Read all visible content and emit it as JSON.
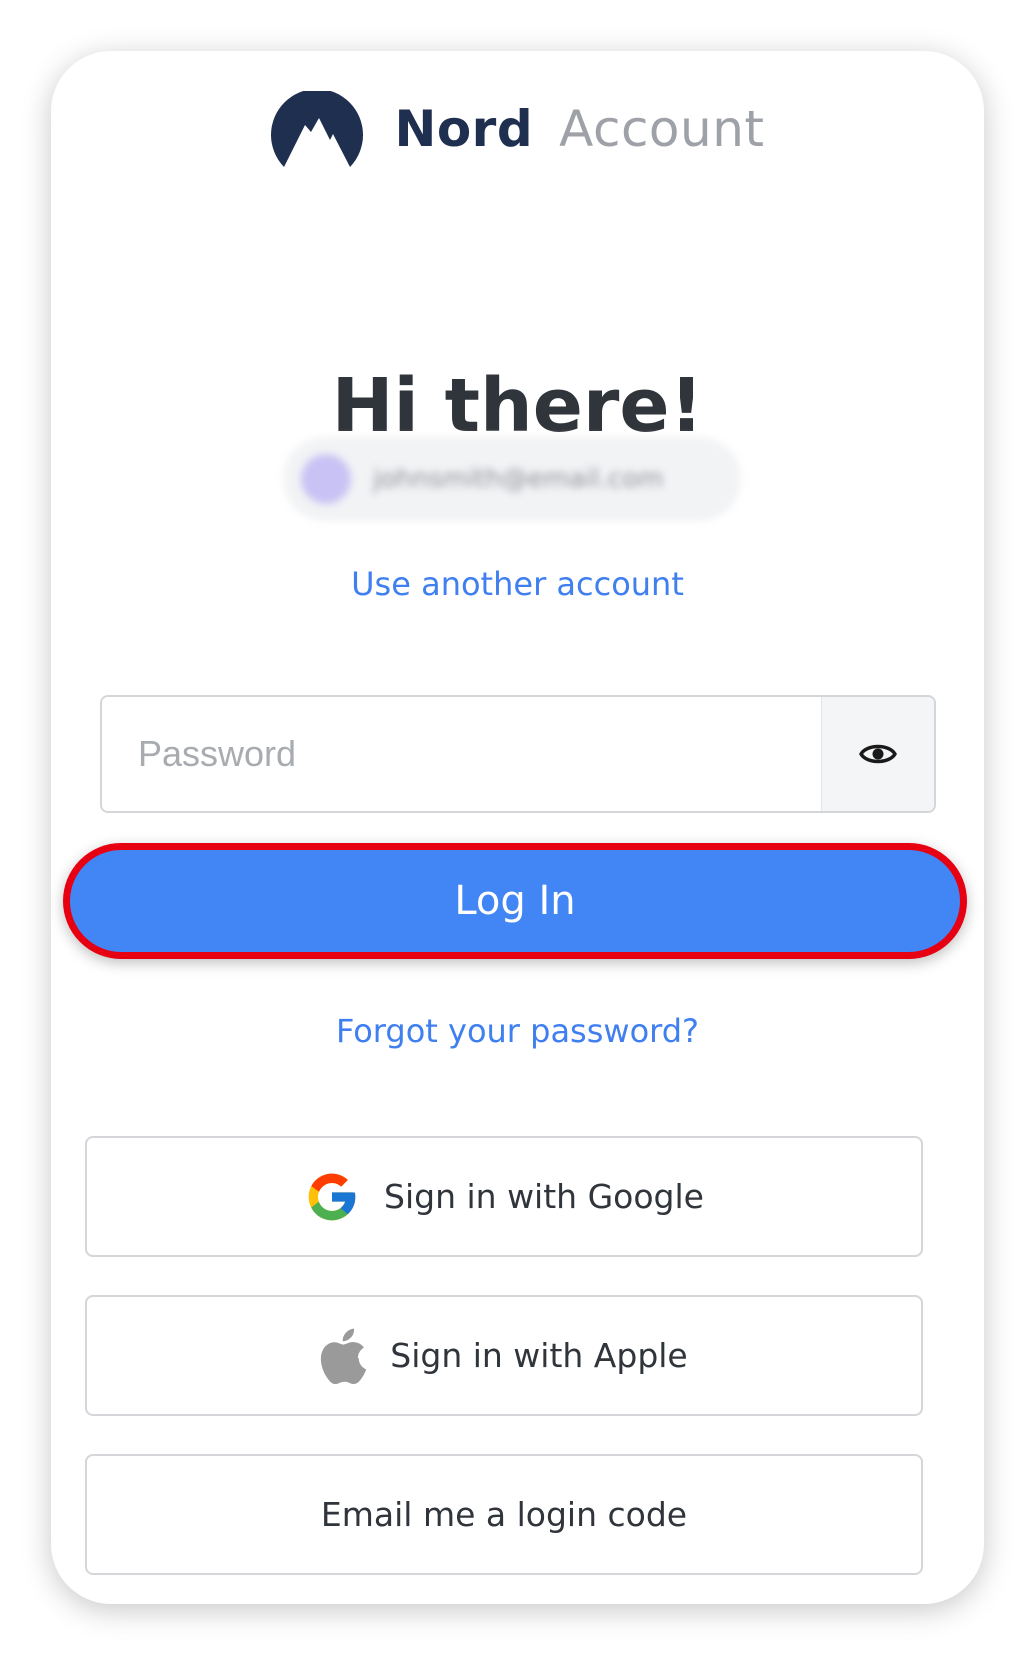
{
  "header": {
    "brand": "Nord",
    "product": "Account",
    "logo_icon": "nord-mountain-icon",
    "brand_color": "#1f2f4f"
  },
  "greeting": "Hi there!",
  "account": {
    "email": "johnsmith@email.com",
    "use_another_label": "Use another account"
  },
  "password": {
    "value": "",
    "placeholder": "Password",
    "reveal_icon": "eye-icon"
  },
  "login_button": {
    "label": "Log In",
    "color": "#4285f4",
    "highlight_color": "#e60012"
  },
  "forgot_password_label": "Forgot your password?",
  "alt_signin": [
    {
      "label": "Sign in with Google",
      "icon": "google-icon"
    },
    {
      "label": "Sign in with Apple",
      "icon": "apple-icon"
    },
    {
      "label": "Email me a login code",
      "icon": ""
    }
  ],
  "link_color": "#3f7ff0"
}
